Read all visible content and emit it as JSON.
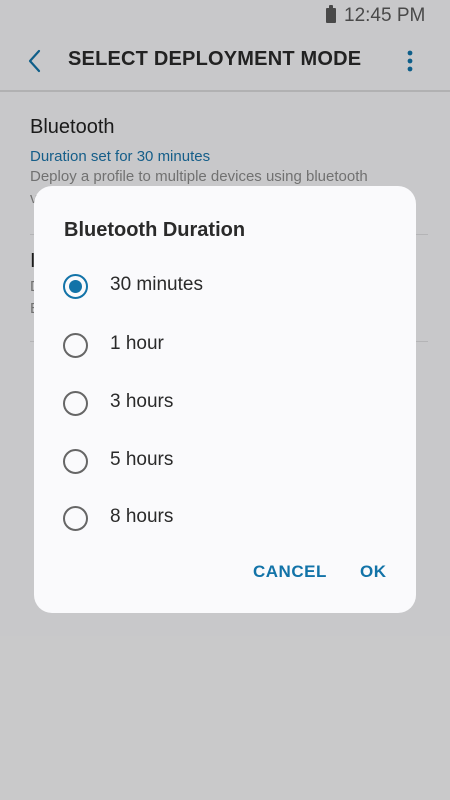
{
  "status_bar": {
    "time": "12:45 PM",
    "battery_icon": "battery-icon"
  },
  "app_bar": {
    "title": "SELECT DEPLOYMENT MODE",
    "back_icon": "back-arrow-icon",
    "more_icon": "more-vert-icon"
  },
  "list": {
    "bluetooth": {
      "title": "Bluetooth",
      "subtitle": "Duration set for 30 minutes",
      "description_line1": "Deploy a profile to multiple devices using bluetooth",
      "description_line2": "v"
    },
    "second": {
      "title_fragment": "I",
      "desc_line1": "D",
      "desc_line2": "E"
    }
  },
  "dialog": {
    "title": "Bluetooth Duration",
    "options": [
      {
        "label": "30 minutes",
        "selected": true
      },
      {
        "label": "1 hour",
        "selected": false
      },
      {
        "label": "3 hours",
        "selected": false
      },
      {
        "label": "5 hours",
        "selected": false
      },
      {
        "label": "8 hours",
        "selected": false
      }
    ],
    "cancel_label": "CANCEL",
    "ok_label": "OK"
  },
  "colors": {
    "accent": "#1273a8",
    "scrim": "rgba(0,0,0,0.18)"
  }
}
